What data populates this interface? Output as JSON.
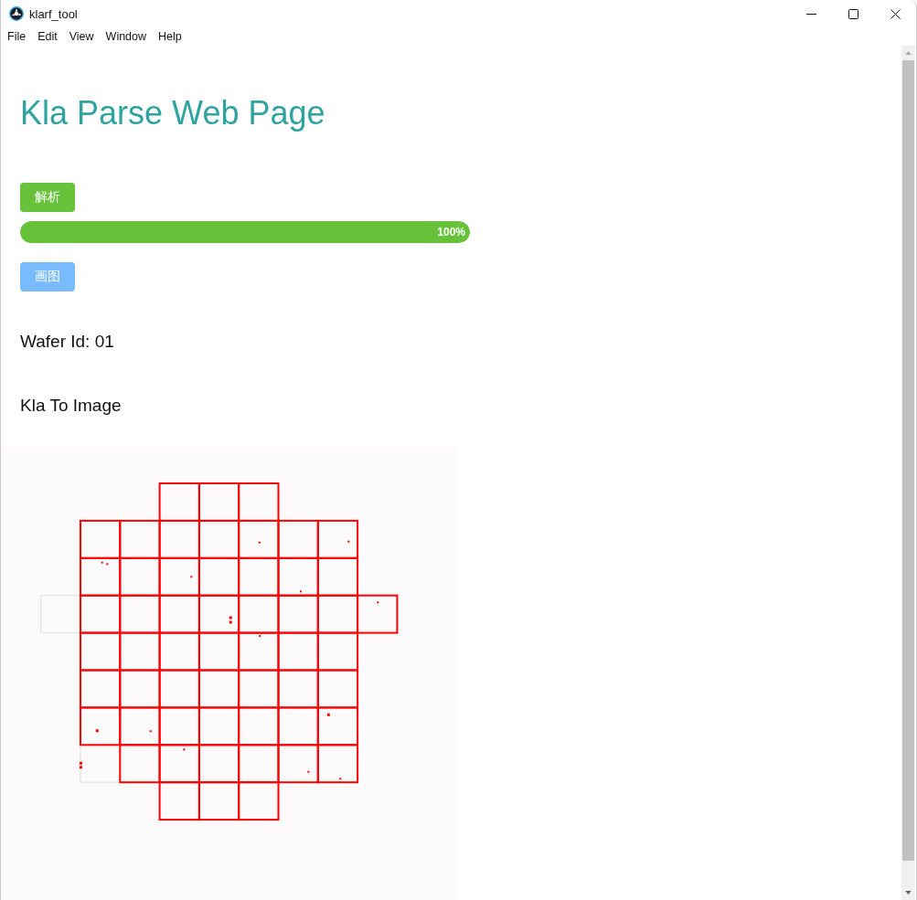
{
  "window": {
    "title": "klarf_tool"
  },
  "menu_bar": {
    "items": [
      "File",
      "Edit",
      "View",
      "Window",
      "Help"
    ]
  },
  "page": {
    "heading": "Kla Parse Web Page",
    "parse_button": {
      "label": "解析",
      "kind": "success"
    },
    "progress": {
      "level": 1,
      "reading": "100%"
    },
    "draw_button": {
      "label": "画图",
      "kind": "primary"
    },
    "wafer_id": "Wafer Id: 01",
    "image_title": "Kla To Image"
  }
}
